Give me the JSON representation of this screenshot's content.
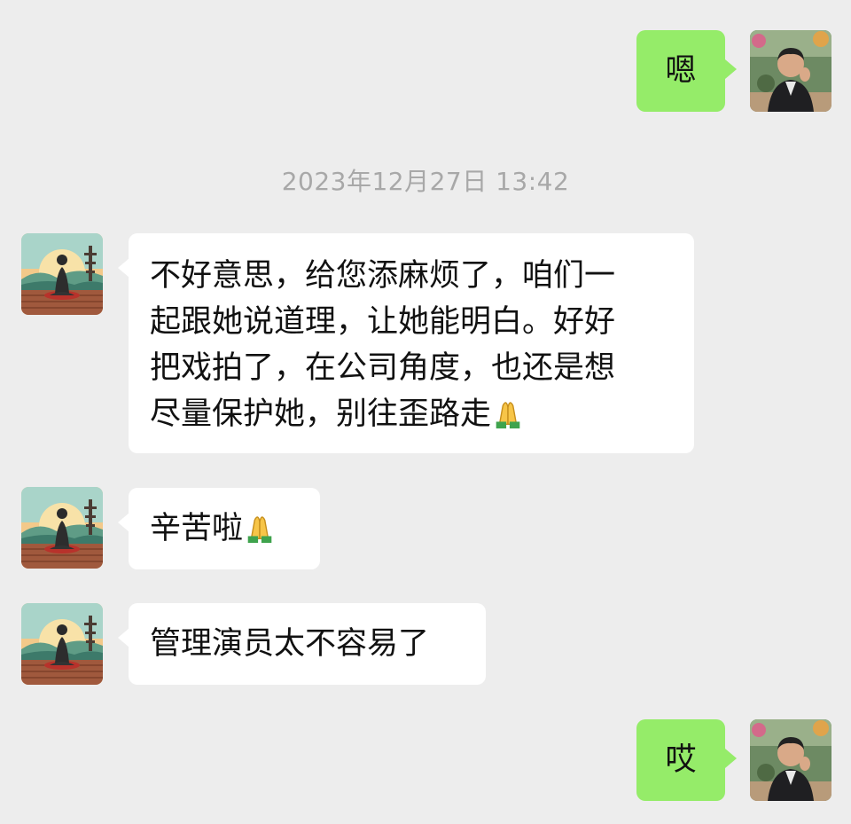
{
  "chat": {
    "timestamp": "2023年12月27日 13:42",
    "messages": [
      {
        "side": "me",
        "text": "嗯",
        "avatar_icon": "man-portrait-avatar"
      },
      {
        "side": "other",
        "text": "不好意思，给您添麻烦了，咱们一\n起跟她说道理，让她能明白。好好\n把戏拍了，在公司角度，也还是想\n尽量保护她，别往歪路走",
        "emoji": "🙏",
        "avatar_icon": "meditating-woman-avatar"
      },
      {
        "side": "other",
        "text": "辛苦啦",
        "emoji": "🙏",
        "avatar_icon": "meditating-woman-avatar"
      },
      {
        "side": "other",
        "text": "管理演员太不容易了",
        "avatar_icon": "meditating-woman-avatar"
      },
      {
        "side": "me",
        "text": "哎",
        "avatar_icon": "man-portrait-avatar"
      }
    ]
  },
  "colors": {
    "background": "#ededed",
    "incoming_bubble": "#ffffff",
    "outgoing_bubble": "#95ec69",
    "timestamp_text": "#a8a8a8"
  }
}
